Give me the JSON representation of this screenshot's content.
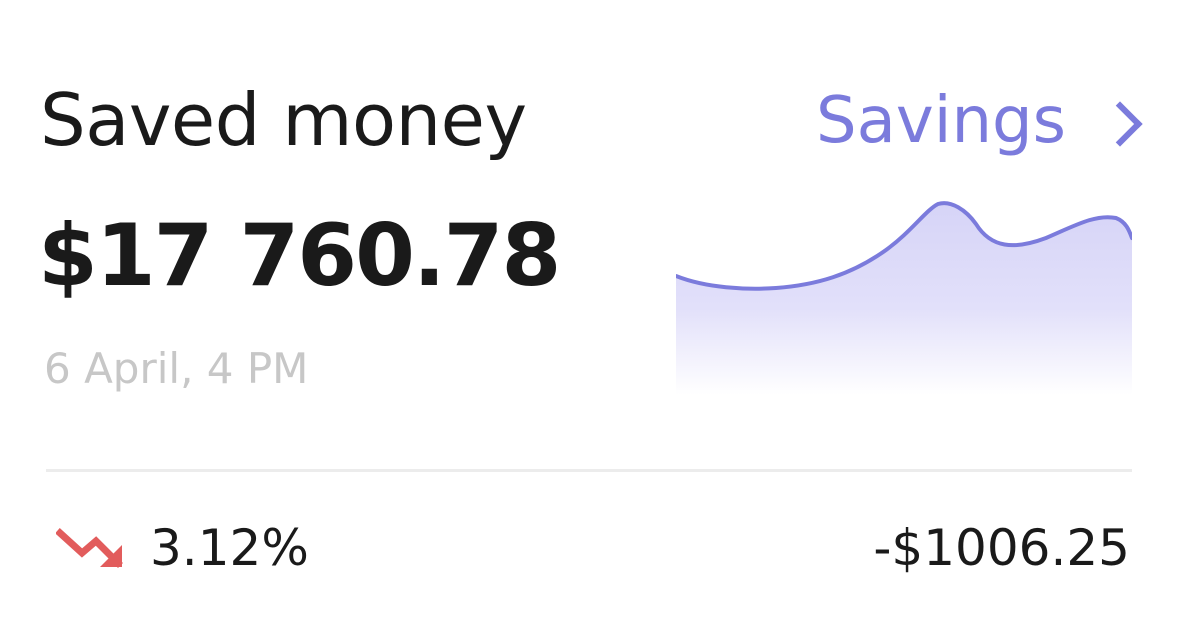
{
  "header": {
    "title": "Saved money",
    "link_label": "Savings"
  },
  "summary": {
    "amount": "$17 760.78",
    "timestamp": "6 April, 4 PM"
  },
  "footer": {
    "trend_icon": "trend-down-icon",
    "change_percent": "3.12%",
    "change_amount": "-$1006.25"
  },
  "colors": {
    "accent": "#7b7bdc",
    "negative": "#e25c5c",
    "text": "#1a1a1a",
    "muted": "#c7c7c7"
  }
}
